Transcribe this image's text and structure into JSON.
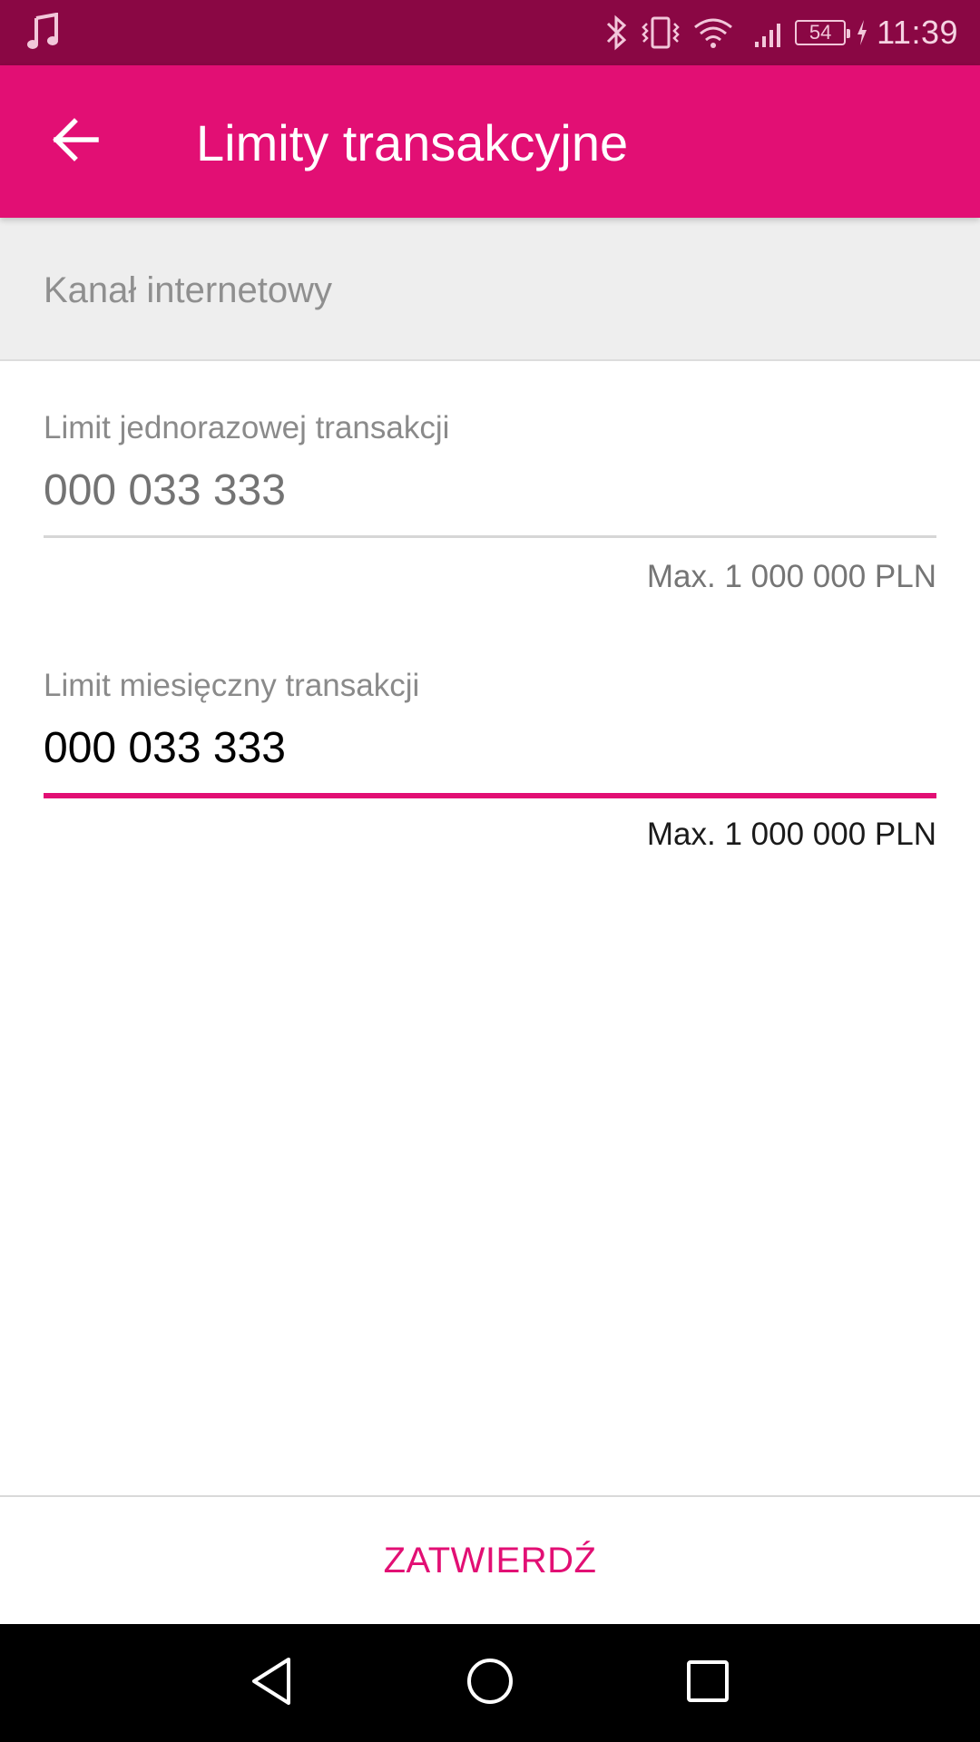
{
  "status_bar": {
    "time": "11:39",
    "battery_level": "54",
    "icons": [
      "music-note-icon",
      "bluetooth-icon",
      "vibrate-icon",
      "wifi-icon",
      "signal-icon",
      "battery-icon",
      "charging-icon"
    ]
  },
  "app_bar": {
    "title": "Limity transakcyjne",
    "back_icon": "arrow-back-icon"
  },
  "section": {
    "title": "Kanał internetowy"
  },
  "fields": {
    "single": {
      "label": "Limit jednorazowej transakcji",
      "value": "000 033 333",
      "helper": "Max. 1 000 000 PLN"
    },
    "monthly": {
      "label": "Limit miesięczny transakcji",
      "value": "000 033 333",
      "helper": "Max. 1 000 000 PLN"
    }
  },
  "actions": {
    "confirm_label": "ZATWIERDŹ"
  },
  "nav_bar": {
    "icons": [
      "nav-back-icon",
      "nav-home-icon",
      "nav-recent-apps-icon"
    ]
  },
  "colors": {
    "accent": "#e20f74",
    "status_bar": "#8a0744",
    "section_bg": "#eeeeee"
  }
}
